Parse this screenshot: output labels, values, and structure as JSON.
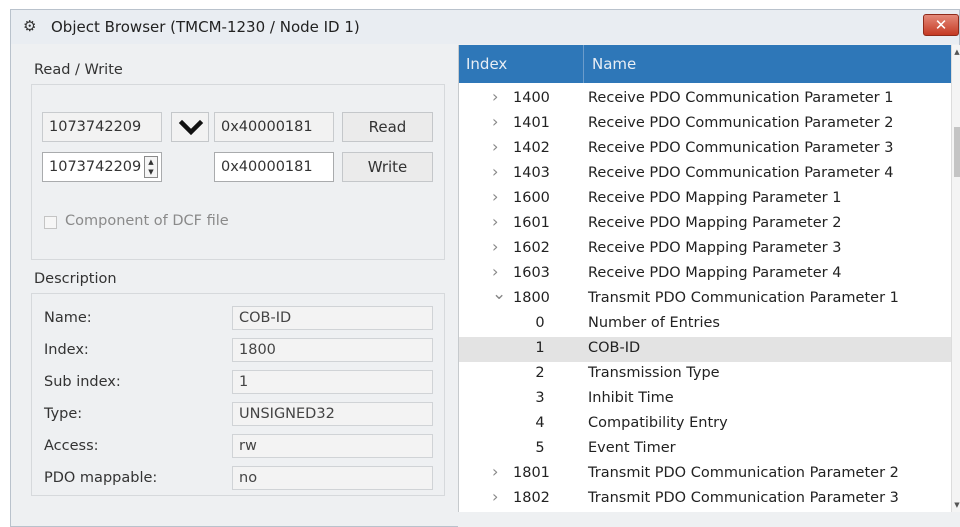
{
  "window": {
    "title": "Object Browser (TMCM-1230 / Node ID 1)",
    "close_glyph": "✕"
  },
  "read_write": {
    "label": "Read / Write",
    "read_value": "1073742209",
    "read_hex": "0x40000181",
    "read_button": "Read",
    "write_value": "1073742209",
    "write_hex": "0x40000181",
    "write_button": "Write",
    "dcf_label": "Component of DCF file"
  },
  "description": {
    "label": "Description",
    "name_label": "Name:",
    "name_value": "COB-ID",
    "index_label": "Index:",
    "index_value": "1800",
    "subindex_label": "Sub index:",
    "subindex_value": "1",
    "type_label": "Type:",
    "type_value": "UNSIGNED32",
    "access_label": "Access:",
    "access_value": "rw",
    "pdo_label": "PDO mappable:",
    "pdo_value": "no"
  },
  "tree": {
    "header_index": "Index",
    "header_name": "Name",
    "header_color": "#2e77b8",
    "rows": [
      {
        "index": "1400",
        "name": "Receive PDO Communication Parameter 1",
        "state": "collapsed"
      },
      {
        "index": "1401",
        "name": "Receive PDO Communication Parameter 2",
        "state": "collapsed"
      },
      {
        "index": "1402",
        "name": "Receive PDO Communication Parameter 3",
        "state": "collapsed"
      },
      {
        "index": "1403",
        "name": "Receive PDO Communication Parameter 4",
        "state": "collapsed"
      },
      {
        "index": "1600",
        "name": "Receive PDO Mapping Parameter 1",
        "state": "collapsed"
      },
      {
        "index": "1601",
        "name": "Receive PDO Mapping Parameter 2",
        "state": "collapsed"
      },
      {
        "index": "1602",
        "name": "Receive PDO Mapping Parameter 3",
        "state": "collapsed"
      },
      {
        "index": "1603",
        "name": "Receive PDO Mapping Parameter 4",
        "state": "collapsed"
      },
      {
        "index": "1800",
        "name": "Transmit PDO Communication Parameter 1",
        "state": "expanded"
      },
      {
        "sub": "0",
        "name": "Number of Entries"
      },
      {
        "sub": "1",
        "name": "COB-ID",
        "selected": true
      },
      {
        "sub": "2",
        "name": "Transmission Type"
      },
      {
        "sub": "3",
        "name": "Inhibit Time"
      },
      {
        "sub": "4",
        "name": "Compatibility Entry"
      },
      {
        "sub": "5",
        "name": "Event Timer"
      },
      {
        "index": "1801",
        "name": "Transmit PDO Communication Parameter 2",
        "state": "collapsed"
      },
      {
        "index": "1802",
        "name": "Transmit PDO Communication Parameter 3",
        "state": "collapsed"
      }
    ]
  }
}
